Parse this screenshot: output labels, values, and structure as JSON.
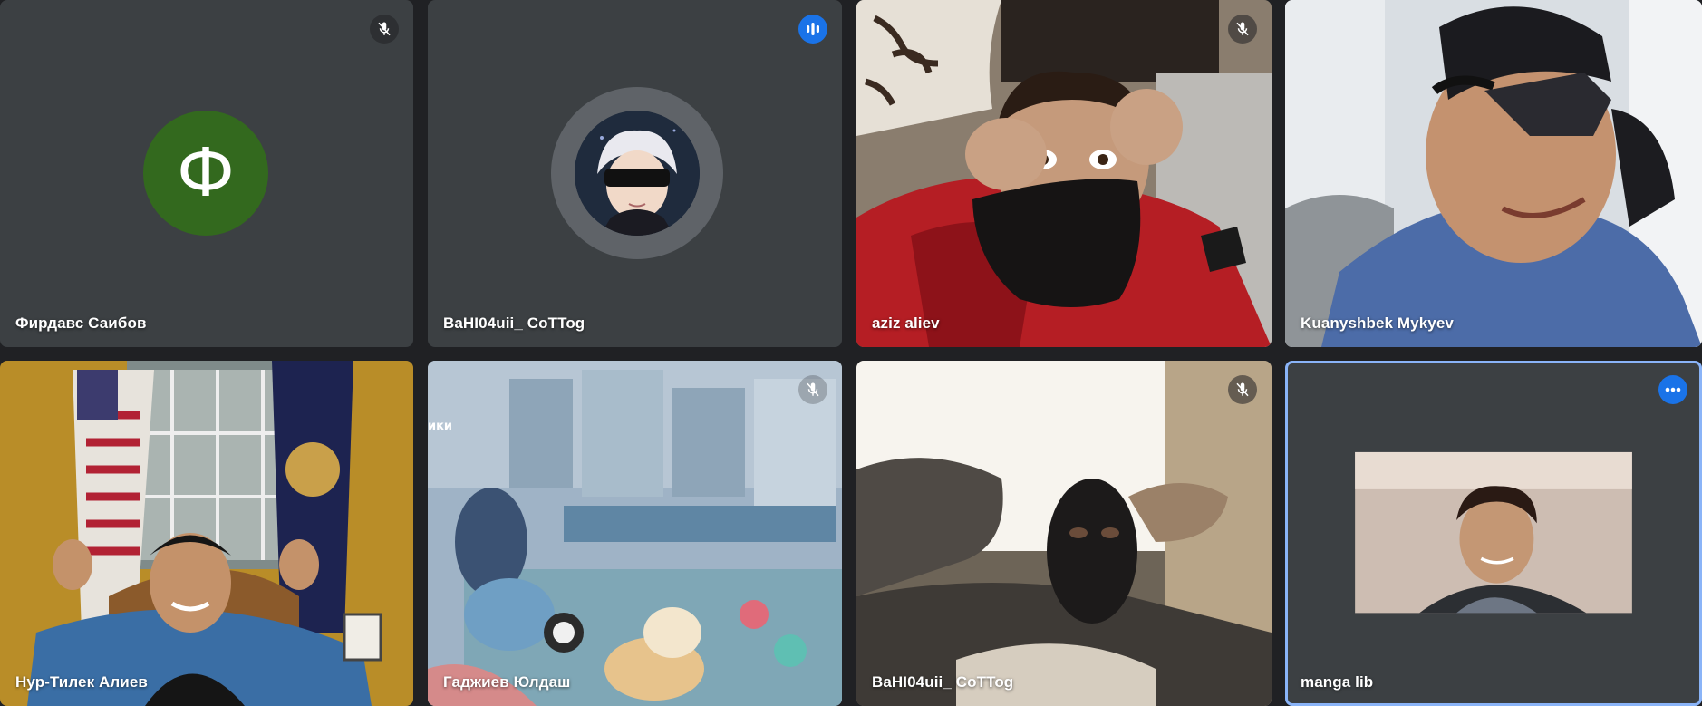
{
  "participants": [
    {
      "name": "Фирдавс Саибов",
      "avatar_letter": "Ф",
      "audio": "muted",
      "type": "letter-avatar"
    },
    {
      "name": "BaHI04uii_ CoTTog",
      "audio": "speaking",
      "type": "image-avatar"
    },
    {
      "name": "aziz aliev",
      "audio": "muted",
      "type": "video"
    },
    {
      "name": "Kuanyshbek Mykyev",
      "audio": "none",
      "type": "video"
    },
    {
      "name": "Нур-Тилек Алиев",
      "audio": "none",
      "type": "video"
    },
    {
      "name": "Гаджиев Юлдаш",
      "audio": "muted",
      "type": "video",
      "overlay_text": "ики"
    },
    {
      "name": "BaHI04uii_ CoTTog",
      "audio": "muted",
      "type": "video"
    },
    {
      "name": "manga lib",
      "audio": "speaking",
      "type": "video"
    }
  ],
  "icons": {
    "muted": "mic-off-icon",
    "speaking": "audio-level-icon"
  },
  "colors": {
    "background": "#202124",
    "tile": "#3c4043",
    "avatar_green": "#33691e",
    "accent_blue": "#1a73e8",
    "active_border": "#8ab4f8"
  }
}
